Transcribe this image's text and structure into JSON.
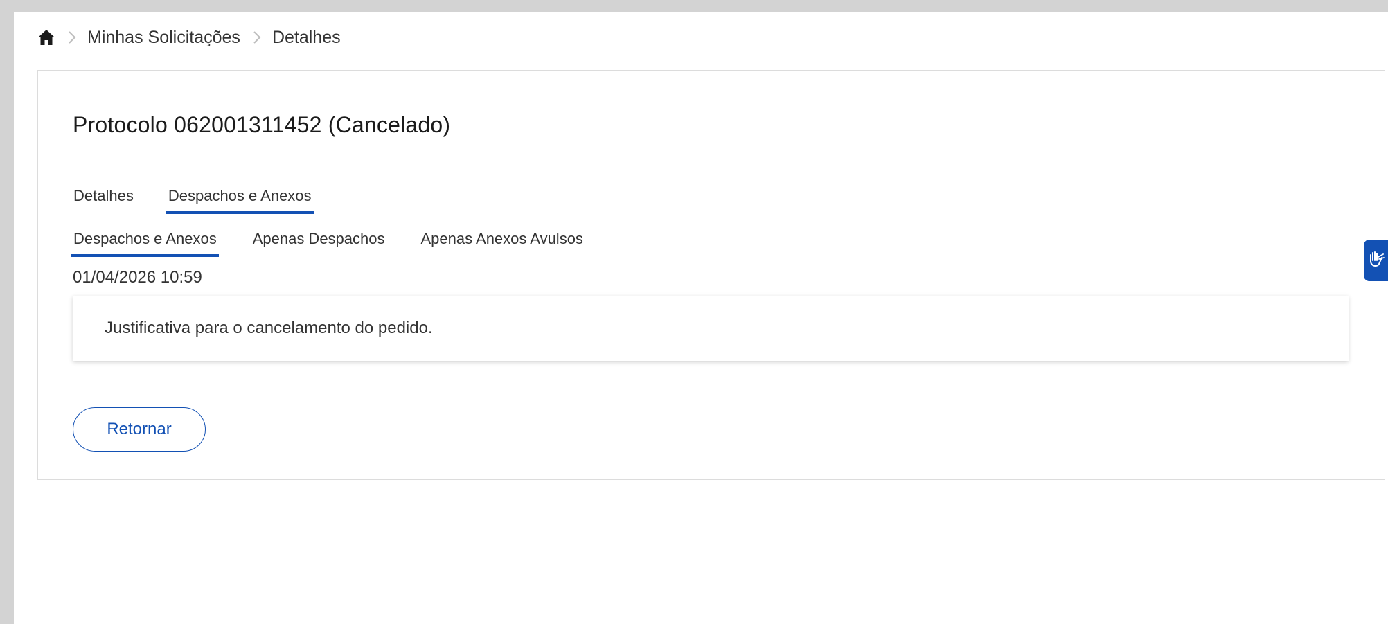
{
  "breadcrumb": {
    "home_icon": "home-icon",
    "items": [
      {
        "label": "Minhas Solicitações"
      },
      {
        "label": "Detalhes"
      }
    ]
  },
  "card": {
    "title": "Protocolo 062001311452 (Cancelado)",
    "main_tabs": [
      {
        "label": "Detalhes",
        "active": false
      },
      {
        "label": "Despachos e Anexos",
        "active": true
      }
    ],
    "sub_tabs": [
      {
        "label": "Despachos e Anexos",
        "active": true
      },
      {
        "label": "Apenas Despachos",
        "active": false
      },
      {
        "label": "Apenas Anexos Avulsos",
        "active": false
      }
    ],
    "dispatch": {
      "date": "01/04/2026 10:59",
      "text": "Justificativa para o cancelamento do pedido."
    },
    "return_label": "Retornar"
  },
  "accessibility_widget": {
    "icon": "hands-sign-language-icon"
  },
  "colors": {
    "accent": "#1351b4",
    "background": "#d3d3d3",
    "surface": "#ffffff"
  }
}
